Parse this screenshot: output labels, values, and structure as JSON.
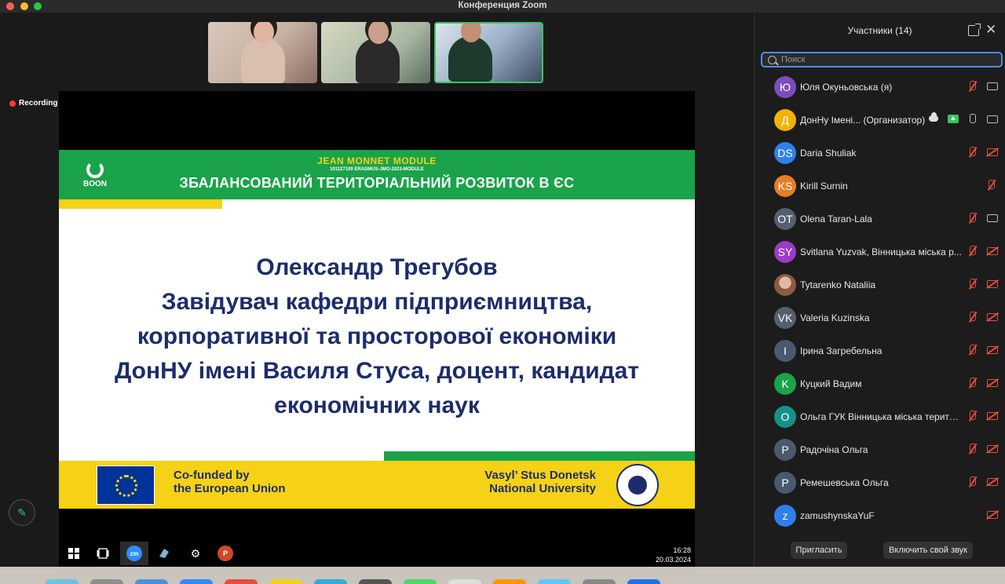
{
  "window": {
    "title": "Конференция Zoom"
  },
  "recording": {
    "label": "Recording"
  },
  "slide": {
    "header_title": "JEAN MONNET MODULE",
    "header_code": "101127100 ERASMUS-JMO-2023-MODULE",
    "header_main": "ЗБАЛАНСОВАНИЙ ТЕРИТОРІАЛЬНИЙ РОЗВИТОК В ЄС",
    "logo_text": "BOON",
    "body_lines": [
      "Олександр Трегубов",
      "Завідувач кафедри підприємництва,",
      "корпоративної та просторової економіки",
      "ДонНУ імені Василя Стуса, доцент, кандидат",
      "економічних наук"
    ],
    "eu_line1": "Co-funded by",
    "eu_line2": "the European Union",
    "uni_line1": "Vasyl’ Stus Donetsk",
    "uni_line2": "National University"
  },
  "taskbar": {
    "time": "16:28",
    "date": "20.03.2024",
    "zoom_badge": "zm",
    "ppt_badge": "P"
  },
  "participants": {
    "title": "Участники (14)",
    "search_placeholder": "Поиск",
    "items": [
      {
        "initials": "Ю",
        "name": "Юля Окуньовська (я)",
        "color": "#7c4dbd"
      },
      {
        "initials": "Д",
        "name": "ДонНу Імені... (Организатор)",
        "color": "#f0b400"
      },
      {
        "initials": "DS",
        "name": "Daria Shuliak",
        "color": "#2f80ed"
      },
      {
        "initials": "KS",
        "name": "Kirill Surnin",
        "color": "#e67e22"
      },
      {
        "initials": "OT",
        "name": "Olena Taran-Lala",
        "color": "#55606e"
      },
      {
        "initials": "SY",
        "name": "Svitlana Yuzvak, Вінницька міська р...",
        "color": "#9b3dc4"
      },
      {
        "initials": "",
        "name": "Tytarenko Nataliia",
        "color": "#8a5b45"
      },
      {
        "initials": "VK",
        "name": "Valeria Kuzinska",
        "color": "#55606e"
      },
      {
        "initials": "І",
        "name": "Ірина Загребельна",
        "color": "#4a5a6e"
      },
      {
        "initials": "K",
        "name": "Куцкий Вадим",
        "color": "#1aa34a"
      },
      {
        "initials": "О",
        "name": "Ольга ГУК Вінницька міська терито...",
        "color": "#16918a"
      },
      {
        "initials": "Р",
        "name": "Радочіна Ольга",
        "color": "#4a5a6e"
      },
      {
        "initials": "Р",
        "name": "Ремешевська Ольга",
        "color": "#4a5a6e"
      },
      {
        "initials": "z",
        "name": "zamushynskaYuF",
        "color": "#2f80ed"
      }
    ],
    "invite_label": "Пригласить",
    "unmute_label": "Включить свой звук"
  }
}
